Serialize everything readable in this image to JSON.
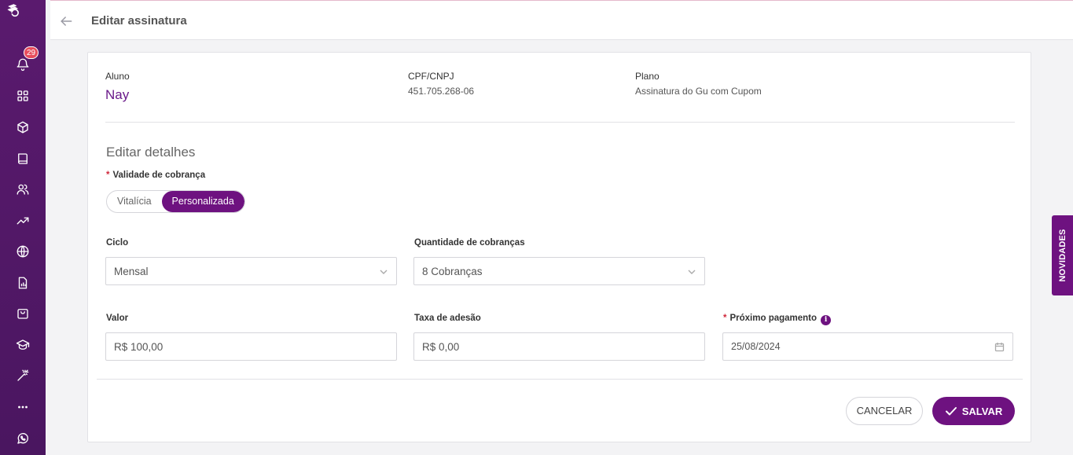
{
  "header": {
    "title": "Editar assinatura"
  },
  "sidebar": {
    "notification_count": "29"
  },
  "summary": {
    "student_label": "Aluno",
    "student_name": "Nay",
    "cpf_label": "CPF/CNPJ",
    "cpf_value": "451.705.268-06",
    "plan_label": "Plano",
    "plan_value": "Assinatura do Gu com Cupom"
  },
  "form": {
    "section_title": "Editar detalhes",
    "validity_label": "Validade de cobrança",
    "validity_options": [
      "Vitalícia",
      "Personalizada"
    ],
    "validity_selected": "Personalizada",
    "cycle_label": "Ciclo",
    "cycle_value": "Mensal",
    "charges_label": "Quantidade de cobranças",
    "charges_value": "8 Cobranças",
    "value_label": "Valor",
    "value_value": "R$ 100,00",
    "fee_label": "Taxa de adesão",
    "fee_value": "R$ 0,00",
    "next_payment_label": "Próximo pagamento",
    "next_payment_value": "25/08/2024"
  },
  "actions": {
    "cancel": "CANCELAR",
    "save": "SALVAR"
  },
  "side_tab": {
    "label": "NOVIDADES"
  },
  "colors": {
    "primary": "#6e1280",
    "sidebar": "#5a1a6e",
    "required": "#d0283c",
    "badge": "#e74c5c"
  }
}
